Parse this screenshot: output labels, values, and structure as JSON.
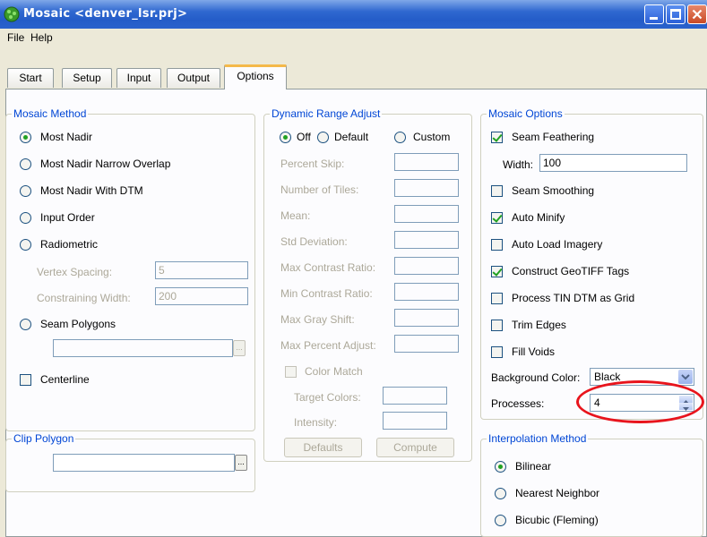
{
  "window": {
    "title": "Mosaic <denver_lsr.prj>"
  },
  "menu": {
    "items": [
      "File",
      "Help"
    ]
  },
  "tabs": [
    {
      "label": "Start"
    },
    {
      "label": "Setup"
    },
    {
      "label": "Input"
    },
    {
      "label": "Output"
    },
    {
      "label": "Options"
    }
  ],
  "active_tab": "Options",
  "mosaic_method": {
    "legend": "Mosaic Method",
    "options": [
      "Most Nadir",
      "Most Nadir Narrow Overlap",
      "Most Nadir With DTM",
      "Input Order",
      "Radiometric"
    ],
    "selected": "Most Nadir",
    "vertex_spacing_label": "Vertex Spacing:",
    "vertex_spacing_value": "5",
    "constraining_width_label": "Constraining Width:",
    "constraining_width_value": "200",
    "seam_polygons_label": "Seam Polygons",
    "seam_polygons_value": "",
    "browse_label": "...",
    "centerline_label": "Centerline"
  },
  "clip_polygon": {
    "legend": "Clip Polygon",
    "value": "",
    "browse_label": "..."
  },
  "dynamic_range": {
    "legend": "Dynamic Range Adjust",
    "modes": [
      "Off",
      "Default",
      "Custom"
    ],
    "selected": "Off",
    "fields": [
      {
        "label": "Percent Skip:"
      },
      {
        "label": "Number of Tiles:"
      },
      {
        "label": "Mean:"
      },
      {
        "label": "Std Deviation:"
      },
      {
        "label": "Max Contrast Ratio:"
      },
      {
        "label": "Min Contrast Ratio:"
      },
      {
        "label": "Max Gray Shift:"
      },
      {
        "label": "Max Percent Adjust:"
      }
    ],
    "color_match_label": "Color Match",
    "target_colors_label": "Target Colors:",
    "intensity_label": "Intensity:",
    "defaults_button": "Defaults",
    "compute_button": "Compute"
  },
  "mosaic_options": {
    "legend": "Mosaic Options",
    "seam_feathering": {
      "label": "Seam Feathering",
      "checked": true
    },
    "width_label": "Width:",
    "width_value": "100",
    "checks": [
      {
        "label": "Seam Smoothing",
        "checked": false
      },
      {
        "label": "Auto Minify",
        "checked": true
      },
      {
        "label": "Auto Load Imagery",
        "checked": false
      },
      {
        "label": "Construct GeoTIFF Tags",
        "checked": true
      },
      {
        "label": "Process TIN DTM as Grid",
        "checked": false
      },
      {
        "label": "Trim Edges",
        "checked": false
      },
      {
        "label": "Fill Voids",
        "checked": false
      }
    ],
    "background_color_label": "Background Color:",
    "background_color_value": "Black",
    "processes_label": "Processes:",
    "processes_value": "4"
  },
  "interpolation": {
    "legend": "Interpolation Method",
    "options": [
      "Bilinear",
      "Nearest Neighbor",
      "Bicubic (Fleming)"
    ],
    "selected": "Bilinear"
  },
  "colors": {
    "annotation_circle": "#e8141c",
    "group_legend": "#0046d5",
    "titlebar": "#245cc8"
  }
}
